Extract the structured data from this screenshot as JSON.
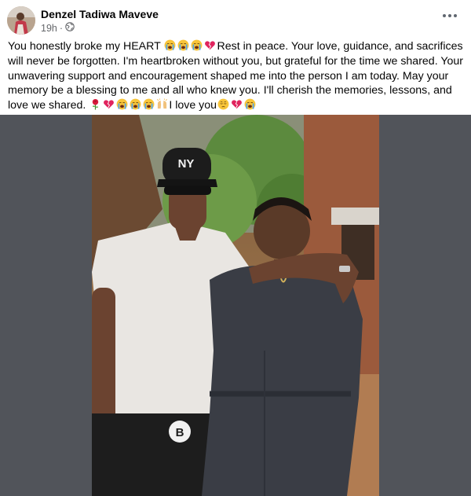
{
  "post": {
    "author": "Denzel Tadiwa Maveve",
    "time": "19h",
    "separator": "·",
    "audience_icon": "globe-icon",
    "text_parts": {
      "p1": "You honestly broke my HEART ",
      "p2": "Rest in peace. Your love, guidance, and sacrifices will never be forgotten. I'm heartbroken without you, but grateful for the time we shared. Your unwavering support and encouragement shaped me into the person I am today. May your memory be a blessing to me and all who knew you. I'll cherish the memories, lessons, and love we shared. ",
      "p3": "I love you"
    },
    "emojis": [
      "loudly-crying-face",
      "broken-heart",
      "wilted-rose",
      "raised-hands",
      "pensive-face"
    ],
    "cap_logo": "NY",
    "shorts_logo": "B"
  },
  "colors": {
    "author_text": "#050505",
    "meta_text": "#65676b",
    "photo_backdrop": "#51545a",
    "broken_heart": "#e0245e",
    "emoji_yellow": "#f8c53a"
  }
}
